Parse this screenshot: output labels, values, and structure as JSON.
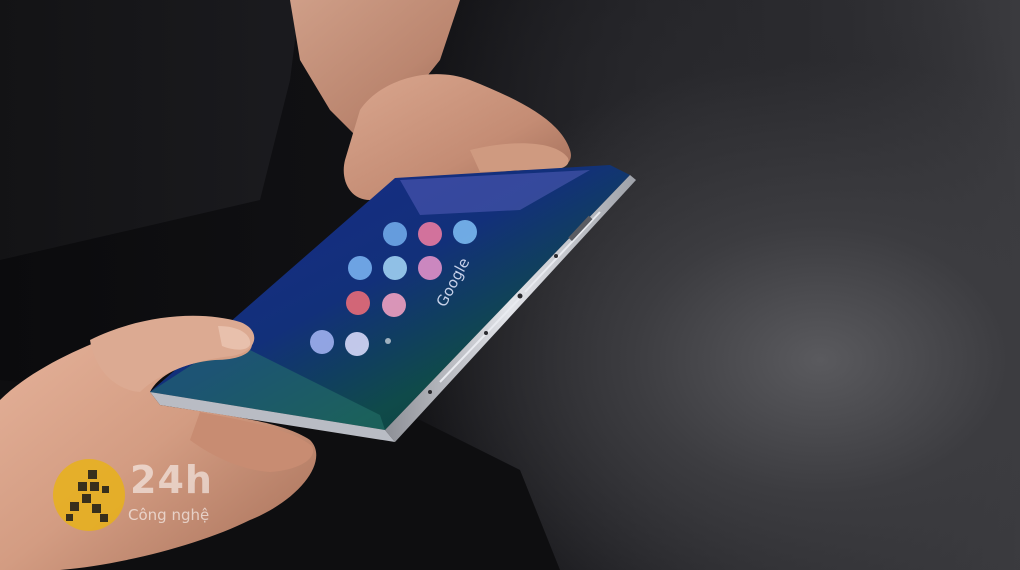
{
  "watermark": {
    "brand": "24h",
    "subtitle": "Công nghệ",
    "accent_color": "#e8b21a"
  },
  "phone": {
    "screen_text": "Google",
    "app_icon_count": 11
  }
}
